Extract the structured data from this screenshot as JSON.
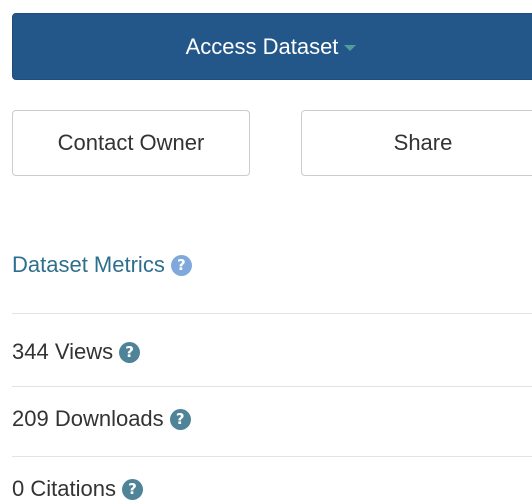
{
  "actions": {
    "access_label": "Access Dataset",
    "contact_label": "Contact Owner",
    "share_label": "Share"
  },
  "metrics": {
    "heading": "Dataset Metrics",
    "views": "344 Views",
    "downloads": "209 Downloads",
    "citations": "0 Citations"
  },
  "icons": {
    "help": "question-circle-icon",
    "caret": "caret-down-icon"
  },
  "colors": {
    "primary": "#245789",
    "heading": "#2e6f8e",
    "help_light": "#7fa9dc",
    "help_dark": "#4f8397"
  }
}
